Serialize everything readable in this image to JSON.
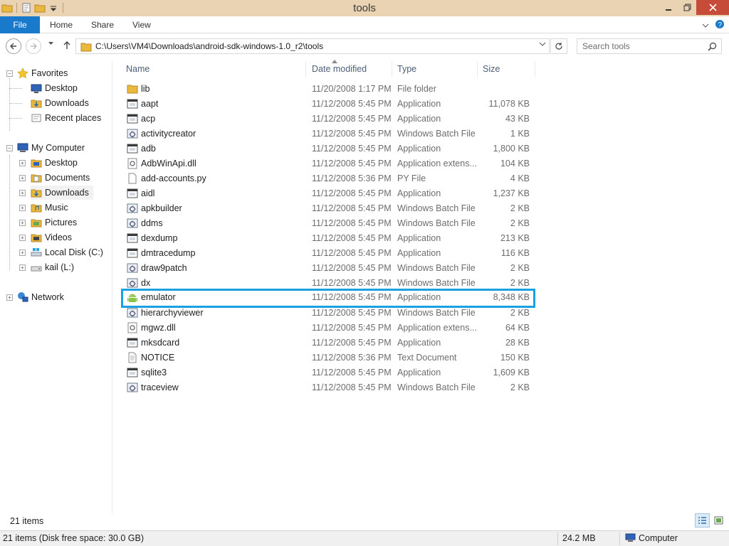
{
  "window": {
    "title": "tools"
  },
  "ribbon": {
    "tabs": [
      {
        "label": "File"
      },
      {
        "label": "Home"
      },
      {
        "label": "Share"
      },
      {
        "label": "View"
      }
    ]
  },
  "address": {
    "path": "C:\\Users\\VM4\\Downloads\\android-sdk-windows-1.0_r2\\tools",
    "search_placeholder": "Search tools"
  },
  "nav": {
    "favorites": {
      "label": "Favorites",
      "items": [
        "Desktop",
        "Downloads",
        "Recent places"
      ]
    },
    "computer": {
      "label": "My Computer",
      "items": [
        "Desktop",
        "Documents",
        "Downloads",
        "Music",
        "Pictures",
        "Videos",
        "Local Disk (C:)",
        "kail (L:)"
      ]
    },
    "network": {
      "label": "Network"
    }
  },
  "columns": {
    "name": "Name",
    "date": "Date modified",
    "type": "Type",
    "size": "Size"
  },
  "files": [
    {
      "name": "lib",
      "date": "11/20/2008 1:17 PM",
      "type": "File folder",
      "size": "",
      "icon": "folder-icon"
    },
    {
      "name": "aapt",
      "date": "11/12/2008 5:45 PM",
      "type": "Application",
      "size": "11,078 KB",
      "icon": "application-icon"
    },
    {
      "name": "acp",
      "date": "11/12/2008 5:45 PM",
      "type": "Application",
      "size": "43 KB",
      "icon": "application-icon"
    },
    {
      "name": "activitycreator",
      "date": "11/12/2008 5:45 PM",
      "type": "Windows Batch File",
      "size": "1 KB",
      "icon": "batch-file-icon"
    },
    {
      "name": "adb",
      "date": "11/12/2008 5:45 PM",
      "type": "Application",
      "size": "1,800 KB",
      "icon": "application-icon"
    },
    {
      "name": "AdbWinApi.dll",
      "date": "11/12/2008 5:45 PM",
      "type": "Application extens...",
      "size": "104 KB",
      "icon": "dll-icon"
    },
    {
      "name": "add-accounts.py",
      "date": "11/12/2008 5:36 PM",
      "type": "PY File",
      "size": "4 KB",
      "icon": "generic-file-icon"
    },
    {
      "name": "aidl",
      "date": "11/12/2008 5:45 PM",
      "type": "Application",
      "size": "1,237 KB",
      "icon": "application-icon"
    },
    {
      "name": "apkbuilder",
      "date": "11/12/2008 5:45 PM",
      "type": "Windows Batch File",
      "size": "2 KB",
      "icon": "batch-file-icon"
    },
    {
      "name": "ddms",
      "date": "11/12/2008 5:45 PM",
      "type": "Windows Batch File",
      "size": "2 KB",
      "icon": "batch-file-icon"
    },
    {
      "name": "dexdump",
      "date": "11/12/2008 5:45 PM",
      "type": "Application",
      "size": "213 KB",
      "icon": "application-icon"
    },
    {
      "name": "dmtracedump",
      "date": "11/12/2008 5:45 PM",
      "type": "Application",
      "size": "116 KB",
      "icon": "application-icon"
    },
    {
      "name": "draw9patch",
      "date": "11/12/2008 5:45 PM",
      "type": "Windows Batch File",
      "size": "2 KB",
      "icon": "batch-file-icon"
    },
    {
      "name": "dx",
      "date": "11/12/2008 5:45 PM",
      "type": "Windows Batch File",
      "size": "2 KB",
      "icon": "batch-file-icon"
    },
    {
      "name": "emulator",
      "date": "11/12/2008 5:45 PM",
      "type": "Application",
      "size": "8,348 KB",
      "icon": "android-icon",
      "highlighted": true
    },
    {
      "name": "hierarchyviewer",
      "date": "11/12/2008 5:45 PM",
      "type": "Windows Batch File",
      "size": "2 KB",
      "icon": "batch-file-icon"
    },
    {
      "name": "mgwz.dll",
      "date": "11/12/2008 5:45 PM",
      "type": "Application extens...",
      "size": "64 KB",
      "icon": "dll-icon"
    },
    {
      "name": "mksdcard",
      "date": "11/12/2008 5:45 PM",
      "type": "Application",
      "size": "28 KB",
      "icon": "application-icon"
    },
    {
      "name": "NOTICE",
      "date": "11/12/2008 5:36 PM",
      "type": "Text Document",
      "size": "150 KB",
      "icon": "text-file-icon"
    },
    {
      "name": "sqlite3",
      "date": "11/12/2008 5:45 PM",
      "type": "Application",
      "size": "1,609 KB",
      "icon": "application-icon"
    },
    {
      "name": "traceview",
      "date": "11/12/2008 5:45 PM",
      "type": "Windows Batch File",
      "size": "2 KB",
      "icon": "batch-file-icon"
    }
  ],
  "footer": {
    "item_count": "21 items",
    "status_left": "21 items (Disk free space: 30.0 GB)",
    "status_size": "24.2 MB",
    "status_location": "Computer"
  },
  "colors": {
    "accent": "#1979ca",
    "highlight_border": "#1ba1e2",
    "titlebar": "#ead3b3",
    "close": "#c74b39"
  }
}
